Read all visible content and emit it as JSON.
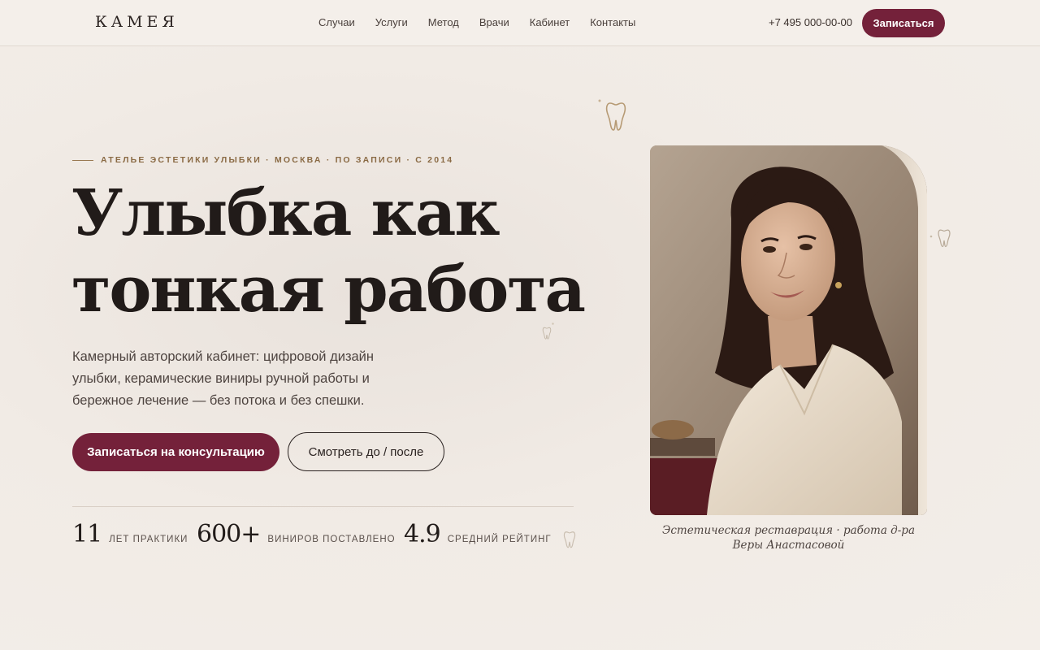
{
  "header": {
    "logo": "КАМЕЯ",
    "nav": [
      "Случаи",
      "Услуги",
      "Метод",
      "Врачи",
      "Кабинет",
      "Контакты"
    ],
    "phone": "+7 495 000-00-00",
    "cta": "Записаться"
  },
  "hero": {
    "eyebrow": "АТЕЛЬЕ ЭСТЕТИКИ УЛЫБКИ · МОСКВА · ПО ЗАПИСИ · С 2014",
    "title_line1": "Улыбка как",
    "title_line2": "тонкая работа",
    "lead": "Камерный авторский кабинет: цифровой дизайн улыбки, керамические виниры ручной работы и бережное лечение — без потока и без спешки.",
    "primary_button": "Записаться на консультацию",
    "secondary_button": "Смотреть до / после",
    "stats": [
      {
        "value": "11",
        "label": "ЛЕТ ПРАКТИКИ"
      },
      {
        "value": "600+",
        "label": "ВИНИРОВ ПОСТАВЛЕНО"
      },
      {
        "value": "4.9",
        "label": "СРЕДНИЙ РЕЙТИНГ"
      }
    ]
  },
  "photo": {
    "caption": "Эстетическая реставрация · работа д-ра Веры Анастасовой"
  },
  "colors": {
    "accent": "#74213a",
    "background": "#f3eee9",
    "gold": "#9a7a52"
  },
  "icons": [
    "tooth-icon"
  ]
}
